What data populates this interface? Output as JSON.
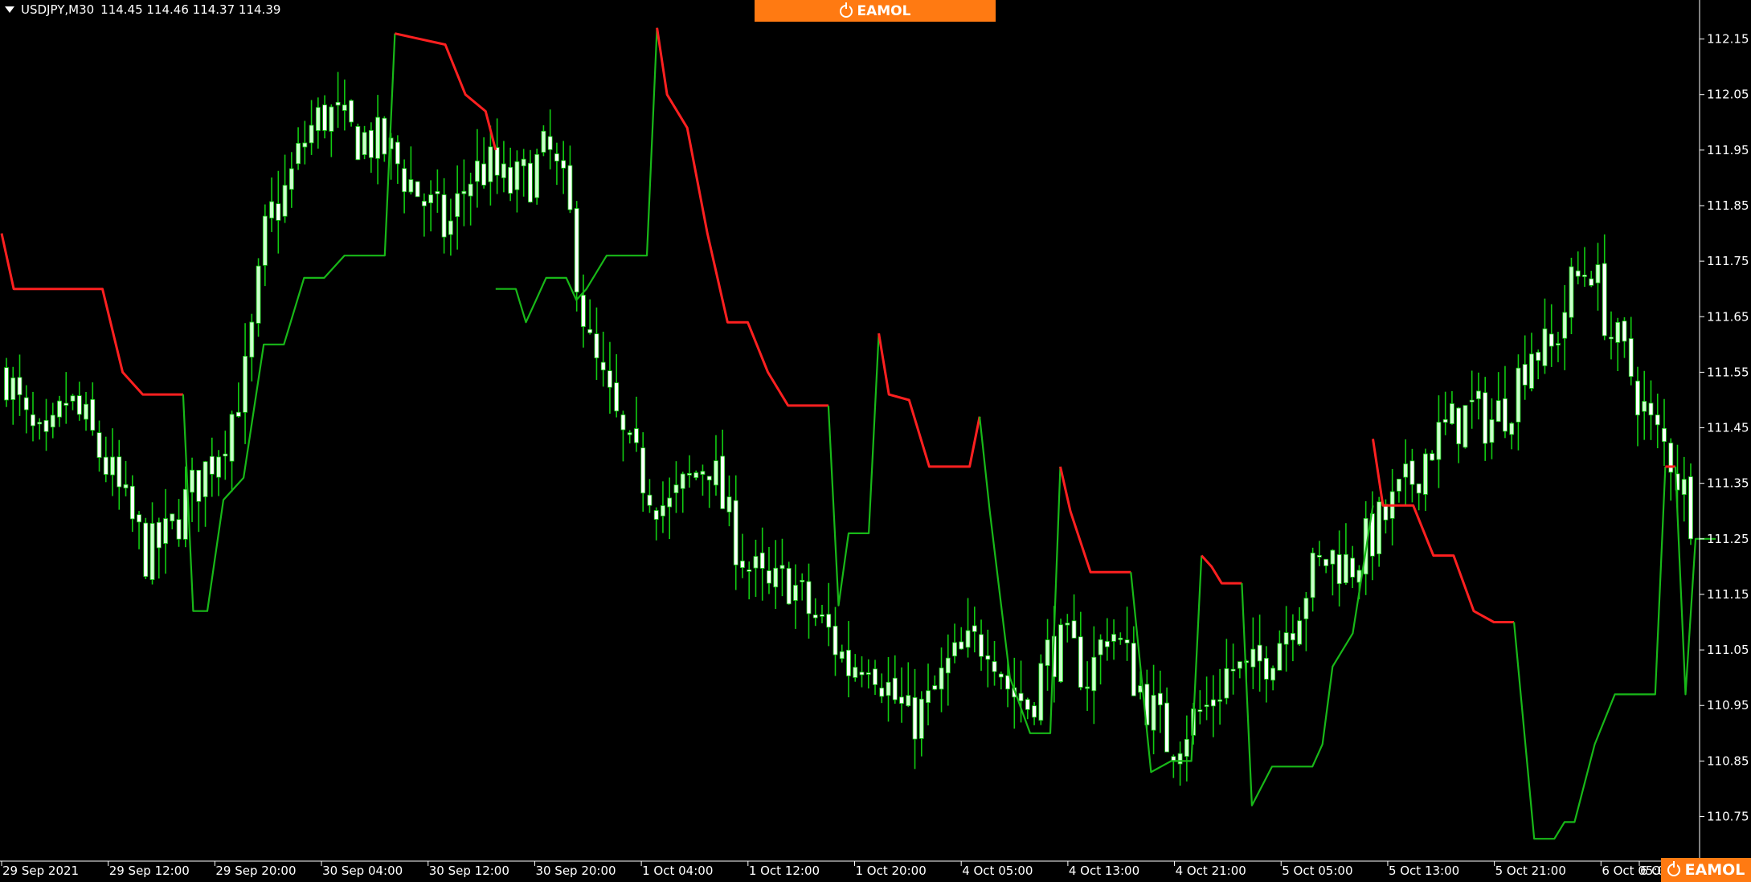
{
  "header": {
    "symbol": "USDJPY,M30",
    "ohlc": "114.45 114.46 114.37 114.39"
  },
  "watermark": {
    "brand": "EAMOL",
    "brand_color": "#ff7a12"
  },
  "colors": {
    "background": "#000000",
    "candle_up": "#ccffcc",
    "candle_down": "#ffffff",
    "wick": "#11cc11",
    "stop_support": "#18b818",
    "stop_resistance": "#ff2020"
  },
  "chart_data": {
    "type": "candlestick",
    "title": "",
    "grid": false,
    "ylim": [
      110.69,
      112.2
    ],
    "yticks": [
      "112.15",
      "112.05",
      "111.95",
      "111.85",
      "111.75",
      "111.65",
      "111.55",
      "111.45",
      "111.35",
      "111.25",
      "111.15",
      "111.05",
      "110.95",
      "110.85",
      "110.75"
    ],
    "xticks": [
      "29 Sep 2021",
      "29 Sep 12:00",
      "29 Sep 20:00",
      "30 Sep 04:00",
      "30 Sep 12:00",
      "30 Sep 20:00",
      "1 Oct 04:00",
      "1 Oct 12:00",
      "1 Oct 20:00",
      "4 Oct 05:00",
      "4 Oct 13:00",
      "4 Oct 21:00",
      "5 Oct 05:00",
      "5 Oct 13:00",
      "5 Oct 21:00",
      "6 Oct 05:00",
      "6 Oct"
    ],
    "series": [
      {
        "name": "price",
        "close_path": [
          111.55,
          111.45,
          111.4,
          111.5,
          111.45,
          111.38,
          111.3,
          111.22,
          111.25,
          111.32,
          111.38,
          111.45,
          111.55,
          111.82,
          111.88,
          111.98,
          112.02,
          111.98,
          111.97,
          111.95,
          111.9,
          111.85,
          111.8,
          111.9,
          111.92,
          111.88,
          111.9,
          111.95,
          111.85,
          111.6,
          111.5,
          111.4,
          111.35,
          111.3,
          111.35,
          111.4,
          111.28,
          111.2,
          111.15,
          111.18,
          111.12,
          111.08,
          111.02,
          111.05,
          110.98,
          110.92,
          110.95,
          111.02,
          111.05,
          111.08,
          110.98,
          110.95,
          111.05,
          111.05,
          111.0,
          111.1,
          111.02,
          110.95,
          110.88,
          110.92,
          110.95,
          111.02,
          111.0,
          111.05,
          111.1,
          111.18,
          111.22,
          111.2,
          111.25,
          111.3,
          111.35,
          111.42,
          111.45,
          111.48,
          111.46,
          111.5,
          111.6,
          111.58,
          111.7,
          111.75,
          111.62,
          111.55,
          111.45,
          111.4,
          111.3
        ]
      },
      {
        "name": "stop_line",
        "segments": [
          {
            "color": "red",
            "points": [
              [
                0,
                111.8
              ],
              [
                0.6,
                111.7
              ],
              [
                5,
                111.7
              ],
              [
                6,
                111.55
              ],
              [
                7,
                111.51
              ],
              [
                9,
                111.51
              ]
            ]
          },
          {
            "color": "green",
            "points": [
              [
                9,
                111.51
              ],
              [
                9.5,
                111.12
              ],
              [
                10.2,
                111.12
              ],
              [
                11,
                111.32
              ],
              [
                12,
                111.36
              ],
              [
                13,
                111.6
              ],
              [
                14,
                111.6
              ],
              [
                15,
                111.72
              ],
              [
                16,
                111.72
              ],
              [
                17,
                111.76
              ],
              [
                19,
                111.76
              ],
              [
                19.5,
                112.16
              ]
            ]
          },
          {
            "color": "red",
            "points": [
              [
                19.5,
                112.16
              ],
              [
                22,
                112.14
              ],
              [
                23,
                112.05
              ],
              [
                24,
                112.02
              ],
              [
                24.5,
                111.95
              ]
            ]
          },
          {
            "color": "green",
            "points": [
              [
                24.5,
                111.7
              ],
              [
                25.5,
                111.7
              ],
              [
                26,
                111.64
              ],
              [
                27,
                111.72
              ],
              [
                28,
                111.72
              ],
              [
                28.5,
                111.68
              ],
              [
                29,
                111.7
              ],
              [
                30,
                111.76
              ],
              [
                32,
                111.76
              ],
              [
                32.5,
                112.17
              ]
            ]
          },
          {
            "color": "red",
            "points": [
              [
                32.5,
                112.17
              ],
              [
                33,
                112.05
              ],
              [
                34,
                111.99
              ],
              [
                35,
                111.8
              ],
              [
                36,
                111.64
              ],
              [
                37,
                111.64
              ],
              [
                38,
                111.55
              ],
              [
                39,
                111.49
              ],
              [
                41,
                111.49
              ]
            ]
          },
          {
            "color": "green",
            "points": [
              [
                41,
                111.49
              ],
              [
                41.5,
                111.13
              ],
              [
                42,
                111.26
              ],
              [
                43,
                111.26
              ],
              [
                43.5,
                111.62
              ]
            ]
          },
          {
            "color": "red",
            "points": [
              [
                43.5,
                111.62
              ],
              [
                44,
                111.51
              ],
              [
                45,
                111.5
              ],
              [
                46,
                111.38
              ],
              [
                48,
                111.38
              ],
              [
                48.5,
                111.47
              ]
            ]
          },
          {
            "color": "green",
            "points": [
              [
                48.5,
                111.47
              ],
              [
                49,
                111.3
              ],
              [
                50,
                111.0
              ],
              [
                51,
                110.9
              ],
              [
                52,
                110.9
              ],
              [
                52.5,
                111.38
              ]
            ]
          },
          {
            "color": "red",
            "points": [
              [
                52.5,
                111.38
              ],
              [
                53,
                111.3
              ],
              [
                54,
                111.19
              ],
              [
                56,
                111.19
              ]
            ]
          },
          {
            "color": "green",
            "points": [
              [
                56,
                111.19
              ],
              [
                57,
                110.83
              ],
              [
                58,
                110.85
              ],
              [
                59,
                110.85
              ],
              [
                59.5,
                111.22
              ]
            ]
          },
          {
            "color": "red",
            "points": [
              [
                59.5,
                111.22
              ],
              [
                60,
                111.2
              ],
              [
                60.5,
                111.17
              ],
              [
                61.5,
                111.17
              ]
            ]
          },
          {
            "color": "green",
            "points": [
              [
                61.5,
                111.17
              ],
              [
                62,
                110.77
              ],
              [
                63,
                110.84
              ],
              [
                65,
                110.84
              ],
              [
                65.5,
                110.88
              ],
              [
                66,
                111.02
              ],
              [
                67,
                111.08
              ],
              [
                68,
                111.31
              ]
            ]
          },
          {
            "color": "red",
            "points": [
              [
                68,
                111.43
              ],
              [
                68.5,
                111.31
              ],
              [
                70,
                111.31
              ],
              [
                71,
                111.22
              ],
              [
                72,
                111.22
              ],
              [
                73,
                111.12
              ],
              [
                74,
                111.1
              ],
              [
                75,
                111.1
              ]
            ]
          },
          {
            "color": "green",
            "points": [
              [
                75,
                111.1
              ],
              [
                76,
                110.71
              ],
              [
                77,
                110.71
              ],
              [
                77.5,
                110.74
              ],
              [
                78,
                110.74
              ],
              [
                79,
                110.88
              ],
              [
                80,
                110.97
              ],
              [
                82,
                110.97
              ],
              [
                82.5,
                111.38
              ]
            ]
          },
          {
            "color": "red",
            "points": [
              [
                82.5,
                111.38
              ],
              [
                83,
                111.38
              ]
            ]
          },
          {
            "color": "green",
            "points": [
              [
                83,
                111.38
              ],
              [
                83.5,
                110.97
              ],
              [
                84,
                111.25
              ],
              [
                85,
                111.25
              ]
            ]
          }
        ]
      }
    ]
  }
}
